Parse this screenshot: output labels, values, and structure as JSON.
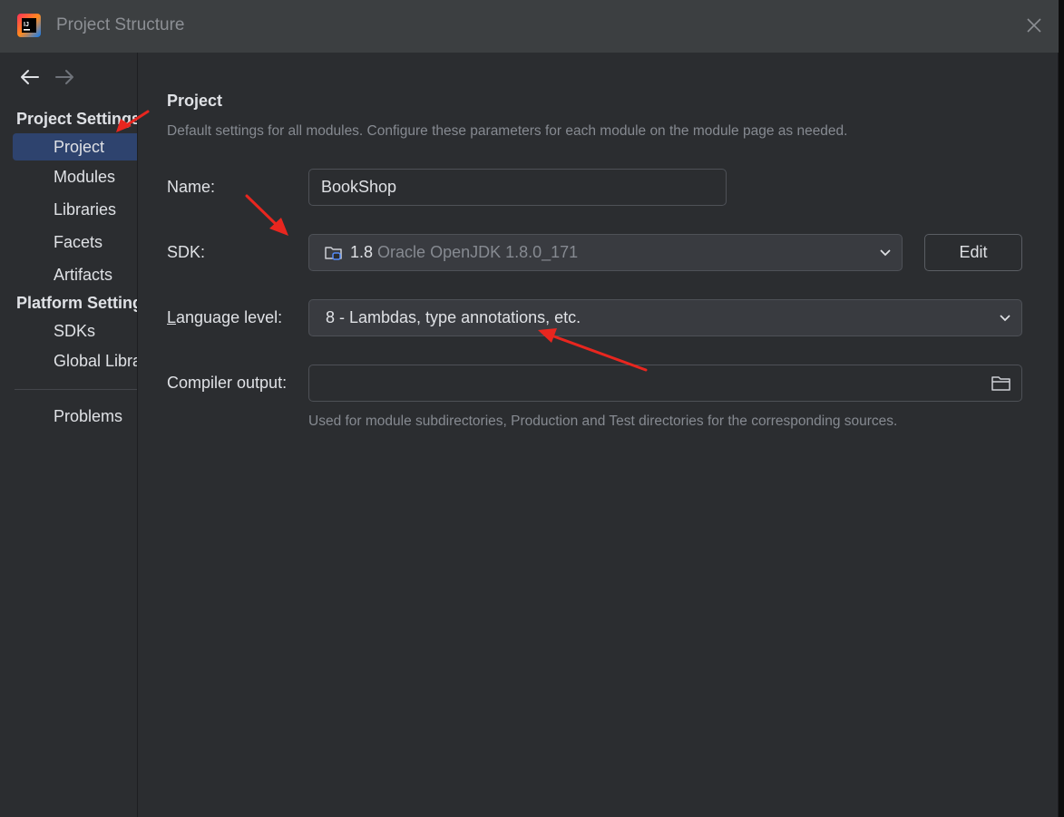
{
  "window": {
    "title": "Project Structure",
    "app_icon": "intellij-idea-icon",
    "close_icon": "close-icon"
  },
  "sidebar": {
    "back_icon": "arrow-left-icon",
    "forward_icon": "arrow-right-icon",
    "group_project": "Project Settings",
    "project_items": [
      "Project",
      "Modules",
      "Libraries",
      "Facets",
      "Artifacts"
    ],
    "group_platform": "Platform Settings",
    "platform_items": [
      "SDKs",
      "Global Libraries"
    ],
    "problems": "Problems",
    "selected": "Project"
  },
  "main": {
    "heading": "Project",
    "description": "Default settings for all modules. Configure these parameters for each module on the module page as needed.",
    "name_label": "Name:",
    "name_value": "BookShop",
    "sdk_label": "SDK:",
    "sdk_version": "1.8",
    "sdk_name": "Oracle OpenJDK 1.8.0_171",
    "edit_label": "Edit",
    "language_label": "Language level:",
    "language_value": "8 - Lambdas, type annotations, etc.",
    "compiler_label": "Compiler output:",
    "compiler_value": "",
    "compiler_hint": "Used for module subdirectories, Production and Test directories for the corresponding sources."
  },
  "colors": {
    "background": "#2b2d30",
    "titlebar": "#3c3f41",
    "selection": "#2e436e",
    "annotation_arrow": "#e8261f"
  }
}
